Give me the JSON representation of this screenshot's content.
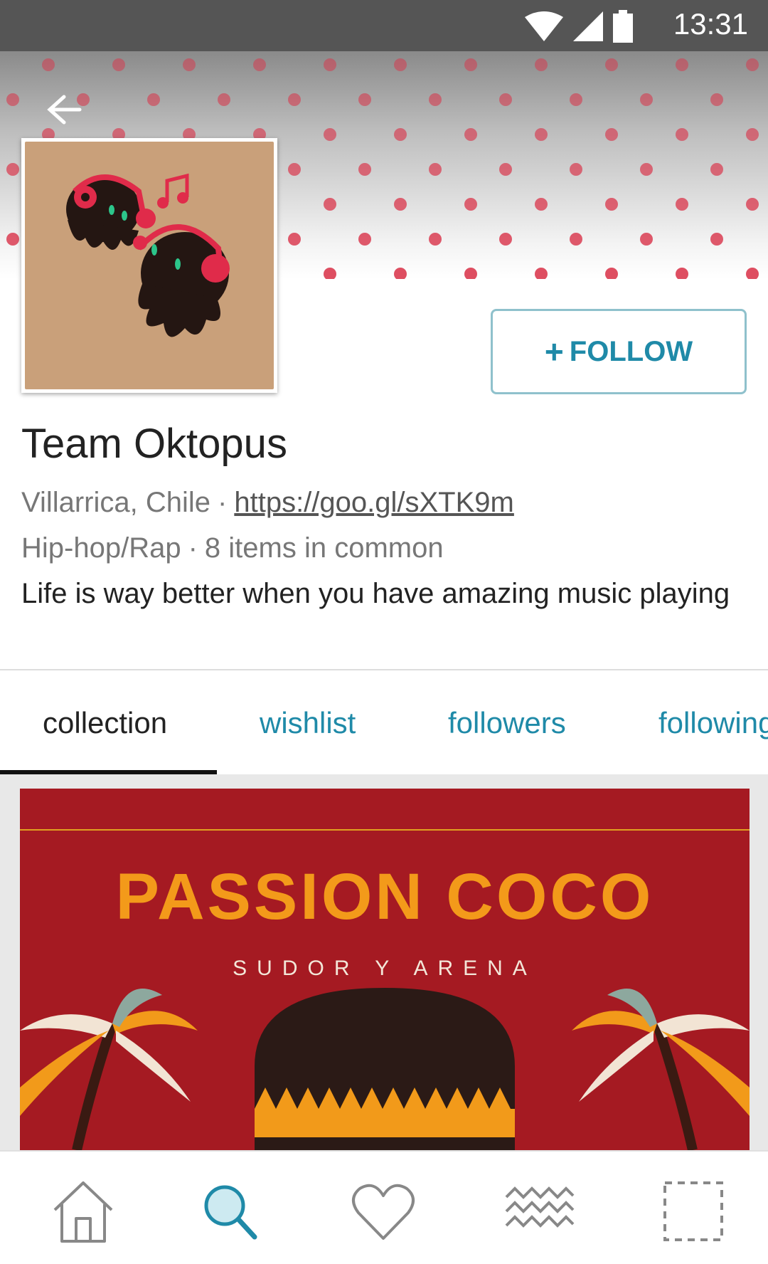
{
  "status_bar": {
    "time": "13:31"
  },
  "header": {
    "back_icon": "arrow-left-icon"
  },
  "profile": {
    "name": "Team Oktopus",
    "location": "Villarrica, Chile",
    "separator": "·",
    "link": "https://goo.gl/sXTK9m",
    "genre": "Hip-hop/Rap",
    "common": "8 items in common",
    "bio": "Life is way better when you have amazing music playing"
  },
  "follow": {
    "plus": "+",
    "label": "FOLLOW"
  },
  "tabs": [
    {
      "label": "collection"
    },
    {
      "label": "wishlist"
    },
    {
      "label": "followers"
    },
    {
      "label": "following"
    }
  ],
  "album": {
    "title": "PASSION COCO",
    "subtitle": "SUDOR Y ARENA"
  },
  "nav": [
    {
      "icon": "home-icon"
    },
    {
      "icon": "search-icon"
    },
    {
      "icon": "heart-icon"
    },
    {
      "icon": "feed-icon"
    },
    {
      "icon": "placeholder-square-icon"
    }
  ],
  "colors": {
    "accent": "#1f8aa8",
    "dot_red": "#d9344a",
    "album_bg": "#a51a22"
  }
}
